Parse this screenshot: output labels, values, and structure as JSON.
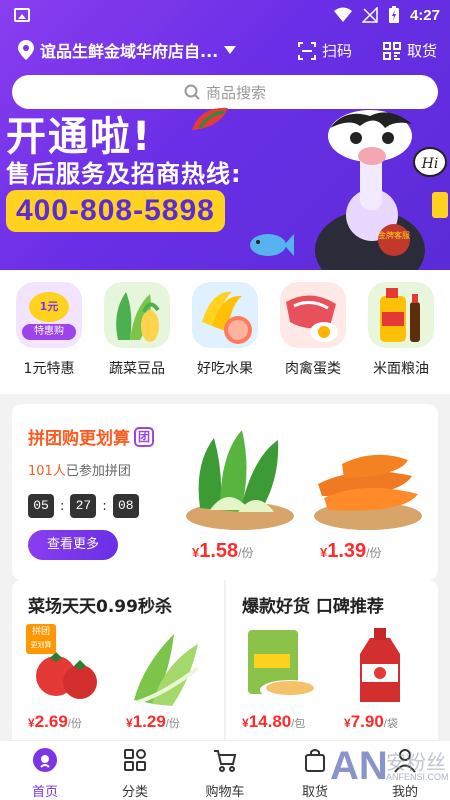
{
  "status_bar": {
    "time": "4:27"
  },
  "header": {
    "store_name": "谊品生鲜金域华府店自...",
    "scan_label": "扫码",
    "pickup_label": "取货"
  },
  "search": {
    "placeholder": "商品搜索"
  },
  "banner": {
    "headline": "开通啦!",
    "subline": "售后服务及招商热线:",
    "hotline": "400-808-5898",
    "badge_text": "金牌客服",
    "hi_text": "Hi"
  },
  "categories": [
    {
      "label": "1元特惠",
      "badge_top": "1元",
      "badge_bottom": "特惠购"
    },
    {
      "label": "蔬菜豆品"
    },
    {
      "label": "好吃水果"
    },
    {
      "label": "肉禽蛋类"
    },
    {
      "label": "米面粮油"
    }
  ],
  "group_buy": {
    "title": "拼团购更划算",
    "badge": "团",
    "joined_count": "101人",
    "joined_suffix": "已参加拼团",
    "timer": {
      "h": "05",
      "m": "27",
      "s": "08"
    },
    "more_label": "查看更多",
    "products": [
      {
        "price_symbol": "¥",
        "price": "1.58",
        "unit": "/份"
      },
      {
        "price_symbol": "¥",
        "price": "1.39",
        "unit": "/份"
      }
    ]
  },
  "flash_sale": {
    "title": "菜场天天0.99秒杀",
    "tag_line1": "拼团",
    "tag_line2": "更划算",
    "products": [
      {
        "price_symbol": "¥",
        "price": "2.69",
        "unit": "/份"
      },
      {
        "price_symbol": "¥",
        "price": "1.29",
        "unit": "/份"
      }
    ]
  },
  "hot_goods": {
    "title": "爆款好货 口碑推荐",
    "products": [
      {
        "price_symbol": "¥",
        "price": "14.80",
        "unit": "/包"
      },
      {
        "price_symbol": "¥",
        "price": "7.90",
        "unit": "/袋"
      }
    ]
  },
  "tabbar": [
    {
      "label": "首页",
      "icon": "home-icon",
      "active": true
    },
    {
      "label": "分类",
      "icon": "category-icon",
      "active": false
    },
    {
      "label": "购物车",
      "icon": "cart-icon",
      "active": false
    },
    {
      "label": "取货",
      "icon": "bag-icon",
      "active": false
    },
    {
      "label": "我的",
      "icon": "profile-icon",
      "active": false
    }
  ],
  "watermark": {
    "brand": "AN",
    "cn": "安粉丝",
    "domain": "ANFENSI.COM"
  },
  "colors": {
    "brand_purple": "#7b36e8",
    "price_red": "#ff2a2a",
    "title_orange": "#ff5a1f",
    "hotline_yellow": "#ffd21f"
  }
}
